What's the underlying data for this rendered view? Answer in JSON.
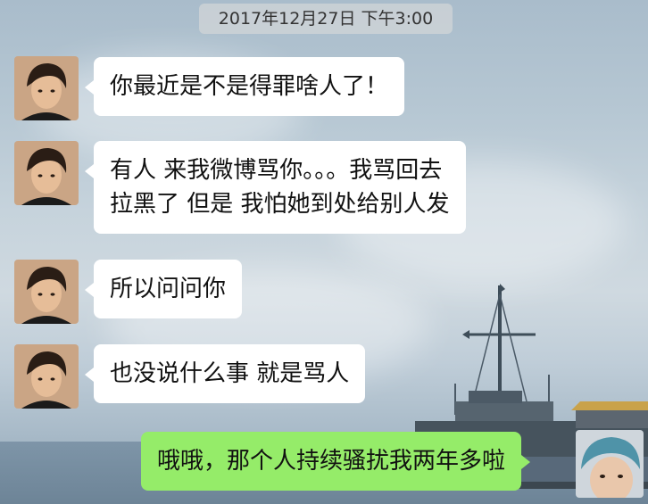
{
  "chat": {
    "timestamp": "2017年12月27日 下午3:00",
    "messages": [
      {
        "side": "left",
        "lines": [
          "你最近是不是得罪啥人了！"
        ]
      },
      {
        "side": "left",
        "lines": [
          "有人 来我微博骂你。。。我骂回去",
          "拉黑了 但是 我怕她到处给别人发"
        ]
      },
      {
        "side": "left",
        "lines": [
          "所以问问你"
        ]
      },
      {
        "side": "left",
        "lines": [
          "也没说什么事  就是骂人"
        ]
      },
      {
        "side": "right",
        "lines": [
          "哦哦，那个人持续骚扰我两年多啦"
        ]
      }
    ]
  },
  "colors": {
    "self_bubble": "#95ec69",
    "other_bubble": "#ffffff",
    "timestamp_bg": "#cdd2d6"
  },
  "icons": {
    "contact_avatar": "avatar-photo",
    "self_avatar": "avatar-photo"
  }
}
